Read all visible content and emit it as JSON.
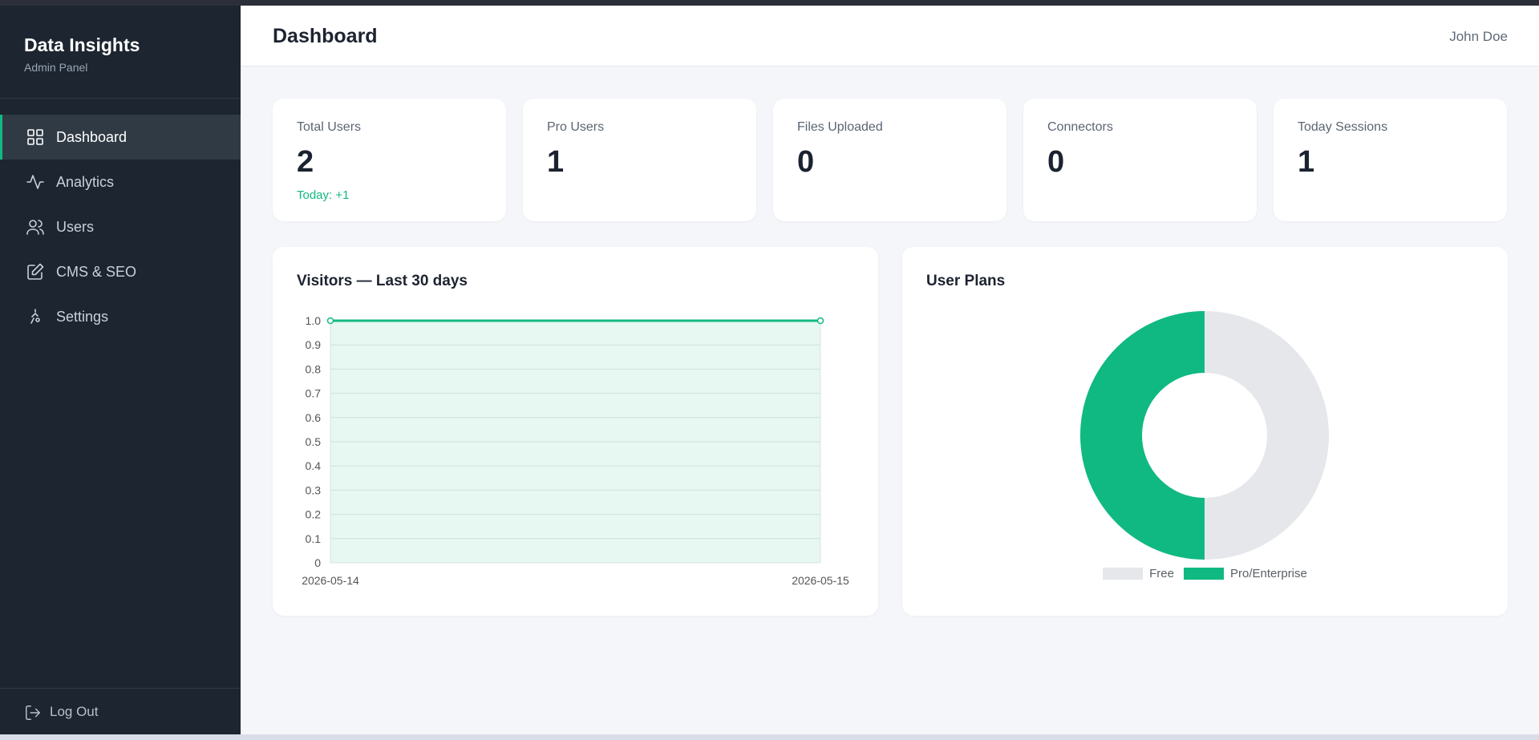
{
  "sidebar": {
    "brand_title": "Data Insights",
    "brand_subtitle": "Admin Panel",
    "items": [
      {
        "label": "Dashboard",
        "icon": "grid-icon",
        "active": true
      },
      {
        "label": "Analytics",
        "icon": "activity-icon",
        "active": false
      },
      {
        "label": "Users",
        "icon": "users-icon",
        "active": false
      },
      {
        "label": "CMS & SEO",
        "icon": "edit-icon",
        "active": false
      },
      {
        "label": "Settings",
        "icon": "settings-icon",
        "active": false
      }
    ],
    "logout_label": "Log Out"
  },
  "header": {
    "title": "Dashboard",
    "user_name": "John Doe"
  },
  "stats": [
    {
      "label": "Total Users",
      "value": "2",
      "note": "Today: +1"
    },
    {
      "label": "Pro Users",
      "value": "1",
      "note": ""
    },
    {
      "label": "Files Uploaded",
      "value": "0",
      "note": ""
    },
    {
      "label": "Connectors",
      "value": "0",
      "note": ""
    },
    {
      "label": "Today Sessions",
      "value": "1",
      "note": ""
    }
  ],
  "visitors_panel": {
    "title": "Visitors — Last 30 days"
  },
  "plans_panel": {
    "title": "User Plans"
  },
  "colors": {
    "accent": "#10b981",
    "sidebar_bg": "#1c2530",
    "free_slice": "#e5e7eb"
  },
  "chart_data": [
    {
      "type": "line",
      "title": "Visitors — Last 30 days",
      "x": [
        "2026-05-14",
        "2026-05-15"
      ],
      "series": [
        {
          "values": [
            1,
            1
          ]
        }
      ],
      "ylim": [
        0,
        1
      ],
      "yticks": [
        "0",
        "0.1",
        "0.2",
        "0.3",
        "0.4",
        "0.5",
        "0.6",
        "0.7",
        "0.8",
        "0.9",
        "1.0"
      ],
      "grid": true,
      "fill": true
    },
    {
      "type": "pie",
      "title": "User Plans",
      "categories": [
        "Free",
        "Pro/Enterprise"
      ],
      "values": [
        1,
        1
      ],
      "colors": [
        "#e5e7eb",
        "#10b981"
      ],
      "donut": true,
      "legend": "bottom"
    }
  ]
}
